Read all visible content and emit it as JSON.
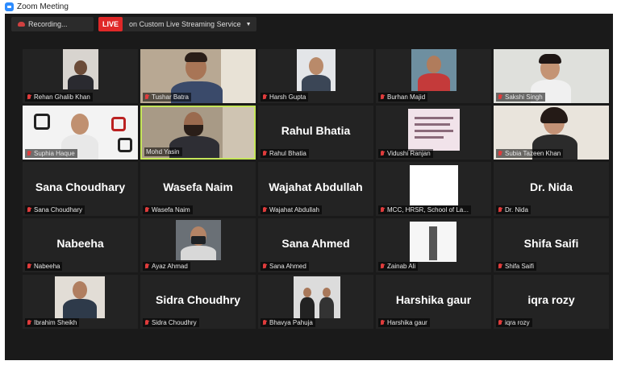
{
  "window": {
    "title": "Zoom Meeting"
  },
  "toolbar": {
    "recording_label": "Recording...",
    "live_badge": "LIVE",
    "live_service": "on Custom Live Streaming Service"
  },
  "colors": {
    "live_red": "#e02828",
    "active_speaker": "#c5e65a",
    "muted_mic": "#e03c3c"
  },
  "participants": [
    {
      "name": "Rehan Ghalib Khan",
      "video": true
    },
    {
      "name": "Tushar Batra",
      "video": true
    },
    {
      "name": "Harsh Gupta",
      "video": true
    },
    {
      "name": "Burhan Majid",
      "video": true
    },
    {
      "name": "Sakshi Singh",
      "video": true
    },
    {
      "name": "Suphia Haque",
      "video": true
    },
    {
      "name": "Mohd Yasin",
      "video": true,
      "active_speaker": true
    },
    {
      "name": "Rahul Bhatia",
      "display": "Rahul Bhatia"
    },
    {
      "name": "Vidushi Ranjan",
      "video": true
    },
    {
      "name": "Subia Tazeen Khan",
      "video": true
    },
    {
      "name": "Sana Choudhary",
      "display": "Sana Choudhary"
    },
    {
      "name": "Wasefa Naim",
      "display": "Wasefa Naim"
    },
    {
      "name": "Wajahat Abdullah",
      "display": "Wajahat Abdullah"
    },
    {
      "name": "MCC, HRSR, School of La...",
      "video": true
    },
    {
      "name": "Dr. Nida",
      "display": "Dr. Nida"
    },
    {
      "name": "Nabeeha",
      "display": "Nabeeha"
    },
    {
      "name": "Ayaz Ahmad",
      "video": true
    },
    {
      "name": "Sana Ahmed",
      "display": "Sana Ahmed"
    },
    {
      "name": "Zainab Ali",
      "video": true
    },
    {
      "name": "Shifa Saifi",
      "display": "Shifa Saifi"
    },
    {
      "name": "Ibrahim Sheikh",
      "video": true
    },
    {
      "name": "Sidra Choudhry",
      "display": "Sidra Choudhry"
    },
    {
      "name": "Bhavya Pahuja",
      "video": true
    },
    {
      "name": "Harshika gaur",
      "display": "Harshika gaur"
    },
    {
      "name": "iqra rozy",
      "display": "iqra rozy"
    }
  ]
}
